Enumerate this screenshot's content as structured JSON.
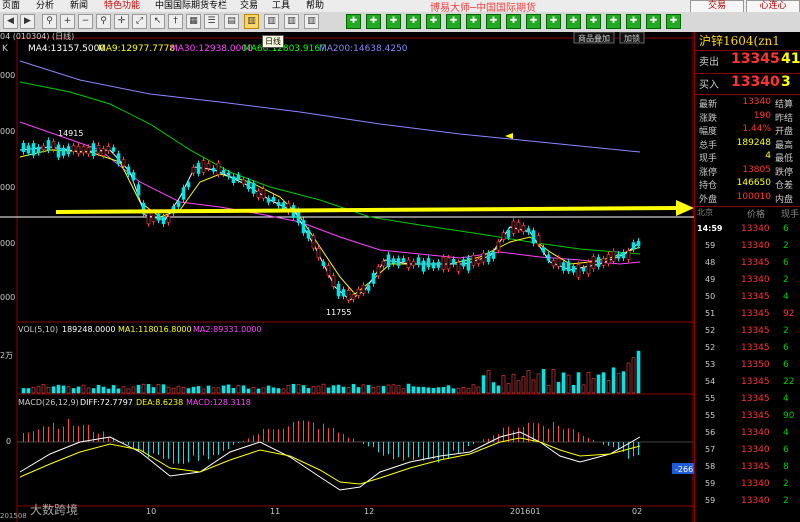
{
  "menu": [
    "页面",
    "分析",
    "新闻",
    "特色功能",
    "中国国际期货专栏",
    "交易",
    "工具",
    "帮助"
  ],
  "brand": "博易大师─中国国际期货",
  "top_buttons": {
    "trade": "交易",
    "heart": "心连心"
  },
  "tooltip": "日线",
  "chart": {
    "code_label": "04 (010304) (日线)",
    "k_label": "K",
    "ma": [
      {
        "label": "MA4:13157.5000",
        "color": "#ffffff"
      },
      {
        "label": "MA9:12977.7778",
        "color": "#ffff00"
      },
      {
        "label": "MA30:12938.0000",
        "color": "#ff44ff"
      },
      {
        "label": "MA60:12803.9167",
        "color": "#00ff00"
      },
      {
        "label": "MA200:14638.4250",
        "color": "#8888ff"
      }
    ],
    "tabs": [
      "商品叠加",
      "加锁"
    ],
    "y_ticks": [
      "000",
      "000",
      "000",
      "000",
      "000"
    ],
    "annotation_high": "14915",
    "annotation_low": "11755",
    "vol_label": "VOL(5,10)",
    "vol_values": [
      {
        "label": "189248.0000",
        "color": "#ffffff"
      },
      {
        "label": "MA1:118016.8000",
        "color": "#ffff00"
      },
      {
        "label": "MA2:89331.0000",
        "color": "#ff44ff"
      }
    ],
    "vol_tick": "2万",
    "macd_label": "MACD(26,12,9)",
    "macd_values": [
      {
        "label": "DIFF:72.7797",
        "color": "#ffffff"
      },
      {
        "label": "DEA:8.6238",
        "color": "#ffff00"
      },
      {
        "label": "MACD:128.3118",
        "color": "#ff44ff"
      }
    ],
    "macd_zero": "0",
    "x_labels": [
      "10",
      "11",
      "12",
      "201601",
      "02"
    ],
    "x_left": "201508",
    "badge": "-266",
    "watermark": "大数跨境"
  },
  "panel": {
    "title": "沪锌1604(zn1",
    "ask": {
      "label": "卖出",
      "price": "13345",
      "vol": "41"
    },
    "bid": {
      "label": "买入",
      "price": "13340",
      "vol": "3"
    },
    "stats": [
      {
        "l": "最新",
        "v": "13340",
        "c": "#ff3333",
        "x": "结算"
      },
      {
        "l": "涨跌",
        "v": "190",
        "c": "#ff3333",
        "x": "昨结"
      },
      {
        "l": "幅度",
        "v": "1.44%",
        "c": "#ff3333",
        "x": "开盘"
      },
      {
        "l": "总手",
        "v": "189248",
        "c": "#ffff00",
        "x": "最高"
      },
      {
        "l": "现手",
        "v": "4",
        "c": "#ffff00",
        "x": "最低"
      },
      {
        "l": "涨停",
        "v": "13805",
        "c": "#ff3333",
        "x": "跌停"
      },
      {
        "l": "持仓",
        "v": "146650",
        "c": "#ffff00",
        "x": "仓差"
      },
      {
        "l": "外盘",
        "v": "100010",
        "c": "#ff3333",
        "x": "内盘"
      }
    ],
    "tick_header": {
      "t": "北京",
      "p": "价格",
      "v": "现手"
    },
    "ticks": [
      {
        "t": "14:59",
        "p": "13340",
        "v": "6",
        "g": true
      },
      {
        "t": "59",
        "p": "13340",
        "v": "2",
        "g": true
      },
      {
        "t": "48",
        "p": "13345",
        "v": "6",
        "g": true
      },
      {
        "t": "49",
        "p": "13340",
        "v": "2",
        "g": true
      },
      {
        "t": "50",
        "p": "13345",
        "v": "4",
        "g": true
      },
      {
        "t": "51",
        "p": "13345",
        "v": "92",
        "g": false
      },
      {
        "t": "52",
        "p": "13345",
        "v": "2",
        "g": true
      },
      {
        "t": "52",
        "p": "13345",
        "v": "6",
        "g": true
      },
      {
        "t": "53",
        "p": "13350",
        "v": "6",
        "g": true
      },
      {
        "t": "54",
        "p": "13345",
        "v": "22",
        "g": true
      },
      {
        "t": "55",
        "p": "13345",
        "v": "4",
        "g": true
      },
      {
        "t": "55",
        "p": "13345",
        "v": "90",
        "g": true
      },
      {
        "t": "56",
        "p": "13340",
        "v": "4",
        "g": true
      },
      {
        "t": "57",
        "p": "13340",
        "v": "6",
        "g": true
      },
      {
        "t": "58",
        "p": "13345",
        "v": "8",
        "g": true
      },
      {
        "t": "59",
        "p": "13340",
        "v": "2",
        "g": true
      },
      {
        "t": "59",
        "p": "13340",
        "v": "2",
        "g": true
      }
    ]
  }
}
